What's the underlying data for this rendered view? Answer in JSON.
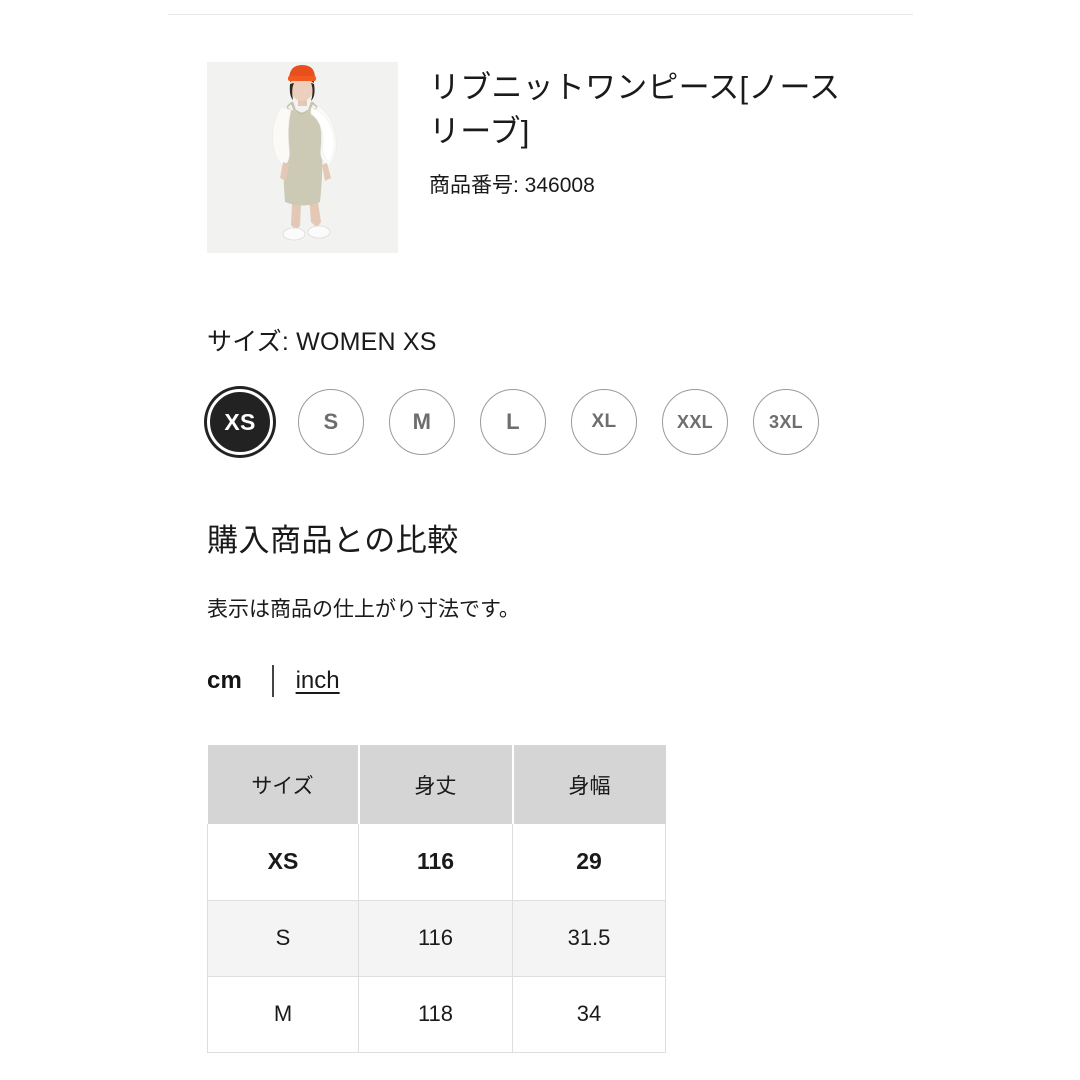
{
  "product": {
    "title": "リブニットワンピース[ノースリーブ]",
    "number_label": "商品番号: 346008",
    "thumbnail_alt": "model-wearing-rib-knit-dress"
  },
  "size_selection": {
    "label": "サイズ: WOMEN XS",
    "selected": "XS",
    "options": [
      {
        "label": "XS",
        "selected": true
      },
      {
        "label": "S",
        "selected": false
      },
      {
        "label": "M",
        "selected": false
      },
      {
        "label": "L",
        "selected": false
      },
      {
        "label": "XL",
        "selected": false
      },
      {
        "label": "XXL",
        "selected": false
      },
      {
        "label": "3XL",
        "selected": false
      }
    ]
  },
  "comparison": {
    "heading": "購入商品との比較",
    "note": "表示は商品の仕上がり寸法です。",
    "units": {
      "cm_label": "cm",
      "inch_label": "inch",
      "active": "cm"
    }
  },
  "size_table": {
    "headers": [
      "サイズ",
      "身丈",
      "身幅"
    ],
    "rows": [
      {
        "size": "XS",
        "length": "116",
        "width": "29",
        "style": "current"
      },
      {
        "size": "S",
        "length": "116",
        "width": "31.5",
        "style": "alt"
      },
      {
        "size": "M",
        "length": "118",
        "width": "34",
        "style": "plain"
      }
    ]
  },
  "scrollbar": {
    "name": "vertical-scrollbar"
  },
  "colors": {
    "selected_chip": "#222222",
    "chip_border": "#9a9a9a",
    "table_header_bg": "#d5d5d5",
    "table_alt_row_bg": "#f4f4f4",
    "divider": "#e6e6e6",
    "scrollbar_thumb": "#808080"
  }
}
